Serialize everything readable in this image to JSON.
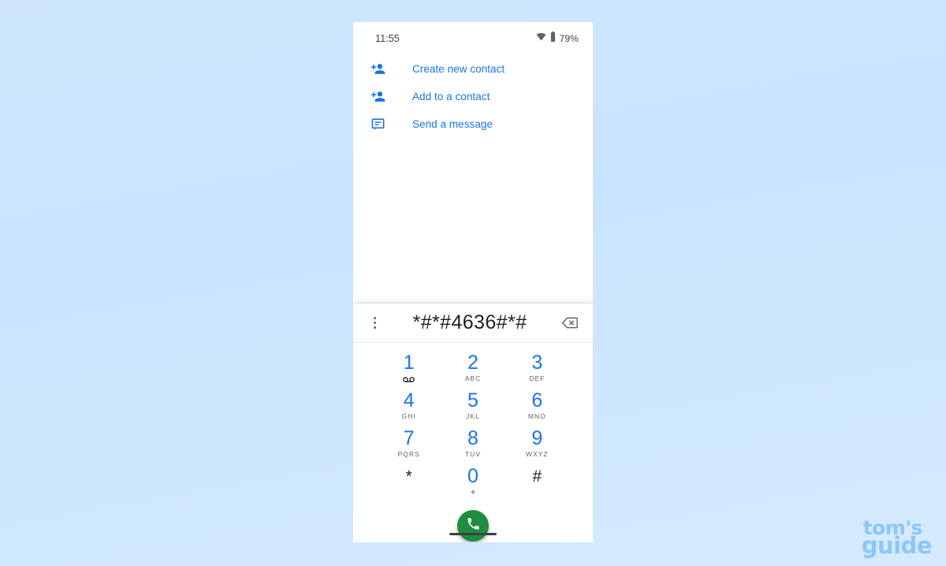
{
  "background": {
    "color_top": "#cfe6fe",
    "color_bottom": "#d5eafe"
  },
  "phone": {
    "status_bar": {
      "time": "11:55",
      "wifi_icon": "wifi-icon",
      "battery_icon": "battery-icon",
      "battery_percent": "79%"
    },
    "contact_actions": [
      {
        "icon": "person-add-icon",
        "label": "Create new contact"
      },
      {
        "icon": "person-add-icon",
        "label": "Add to a contact"
      },
      {
        "icon": "message-icon",
        "label": "Send a message"
      }
    ],
    "dialpad": {
      "overflow_icon": "more-vert-icon",
      "dialed_number": "*#*#4636#*#",
      "backspace_icon": "backspace-icon",
      "keys": [
        {
          "digit": "1",
          "sub": "",
          "sub_icon": "voicemail-icon",
          "style": "blue"
        },
        {
          "digit": "2",
          "sub": "ABC",
          "sub_icon": "",
          "style": "blue"
        },
        {
          "digit": "3",
          "sub": "DEF",
          "sub_icon": "",
          "style": "blue"
        },
        {
          "digit": "4",
          "sub": "GHI",
          "sub_icon": "",
          "style": "blue"
        },
        {
          "digit": "5",
          "sub": "JKL",
          "sub_icon": "",
          "style": "blue"
        },
        {
          "digit": "6",
          "sub": "MNO",
          "sub_icon": "",
          "style": "blue"
        },
        {
          "digit": "7",
          "sub": "PQRS",
          "sub_icon": "",
          "style": "blue"
        },
        {
          "digit": "8",
          "sub": "TUV",
          "sub_icon": "",
          "style": "blue"
        },
        {
          "digit": "9",
          "sub": "WXYZ",
          "sub_icon": "",
          "style": "blue"
        },
        {
          "digit": "*",
          "sub": "",
          "sub_icon": "",
          "style": "dark"
        },
        {
          "digit": "0",
          "sub": "+",
          "sub_icon": "",
          "style": "blue"
        },
        {
          "digit": "#",
          "sub": "",
          "sub_icon": "",
          "style": "dark"
        }
      ],
      "call_button": {
        "icon": "phone-icon",
        "color": "#1e8e3e"
      }
    },
    "home_indicator": "home-indicator"
  },
  "watermark": {
    "line1": "tom's",
    "line2": "guide",
    "color": "#8dc6f7"
  },
  "colors": {
    "accent_blue": "#1a73e8",
    "text_dark": "#202124",
    "text_secondary": "#5f6368",
    "call_green": "#1e8e3e"
  }
}
